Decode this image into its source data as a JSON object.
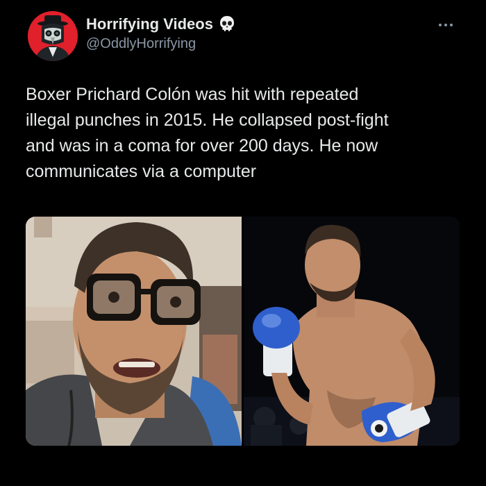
{
  "author": {
    "display_name": "Horrifying Videos",
    "handle": "@OddlyHorrifying",
    "badge_icon": "skull-emoji-icon",
    "avatar_icon": "plague-doctor-avatar-icon",
    "avatar_color": "#e0202a"
  },
  "menu": {
    "icon": "more-dots-icon"
  },
  "tweet": {
    "text": "Boxer Prichard Colón was hit with repeated\nillegal punches in 2015. He collapsed post-fight\nand was in a coma for over 200 days. He now\ncommunicates via a computer"
  },
  "media": {
    "count": 2
  },
  "colors": {
    "background": "#000000",
    "primary_text": "#e7e9ea",
    "secondary_text": "#8b98a5"
  }
}
